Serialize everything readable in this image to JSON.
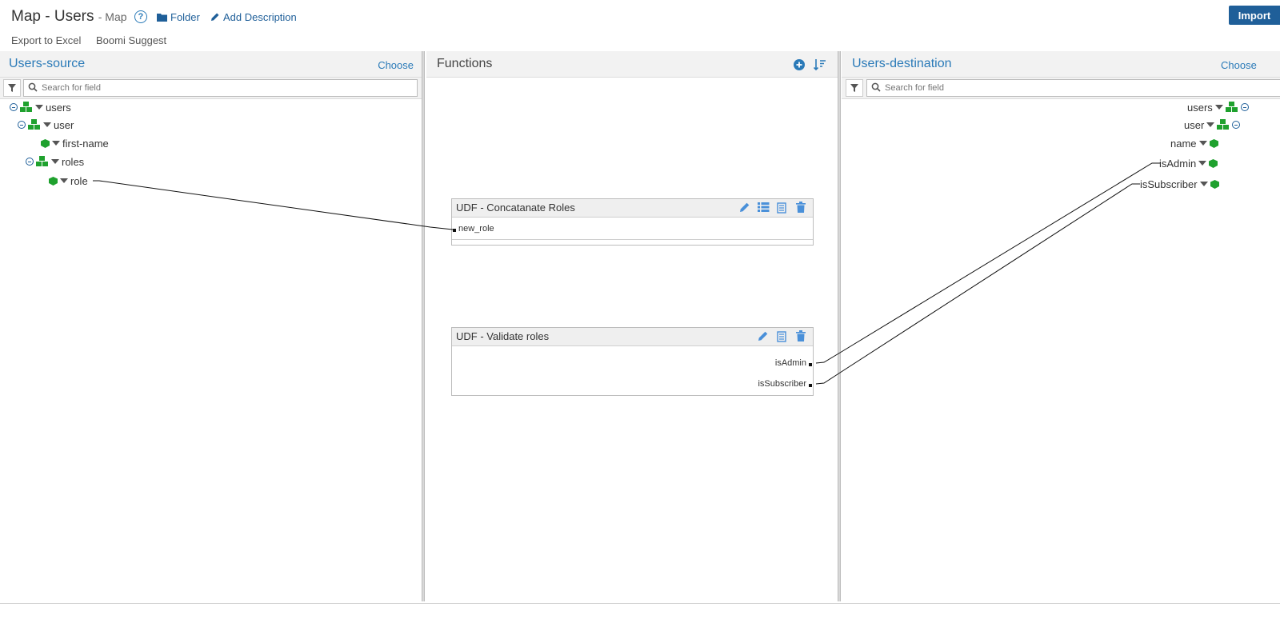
{
  "header": {
    "title": "Map - Users",
    "subtitle": "- Map",
    "folder_label": "Folder",
    "description_label": "Add Description",
    "import_label": "Import"
  },
  "submenu": {
    "export_label": "Export to Excel",
    "suggest_label": "Boomi Suggest"
  },
  "source": {
    "title": "Users-source",
    "choose_label": "Choose",
    "search_placeholder": "Search for field",
    "tree": [
      {
        "label": "users"
      },
      {
        "label": "user"
      },
      {
        "label": "first-name"
      },
      {
        "label": "roles"
      },
      {
        "label": "role"
      }
    ]
  },
  "functions": {
    "title": "Functions",
    "boxes": [
      {
        "title": "UDF - Concatanate Roles",
        "inputs": [
          "new_role"
        ]
      },
      {
        "title": "UDF - Validate roles",
        "outputs": [
          "isAdmin",
          "isSubscriber"
        ]
      }
    ]
  },
  "destination": {
    "title": "Users-destination",
    "choose_label": "Choose",
    "search_placeholder": "Search for field",
    "tree": [
      {
        "label": "users"
      },
      {
        "label": "user"
      },
      {
        "label": "name"
      },
      {
        "label": "isAdmin"
      },
      {
        "label": "isSubscriber"
      }
    ]
  },
  "colors": {
    "accent": "#2a7ab8",
    "import_button": "#1f5f99",
    "element_icon": "#1fa12e",
    "panel_header": "#f2f2f2"
  },
  "icons": {
    "help": "help-icon",
    "folder": "folder-icon",
    "pencil": "pencil-icon",
    "filter": "filter-icon",
    "search": "search-icon",
    "add": "plus-circle-icon",
    "sort": "sort-icon",
    "list": "list-icon",
    "copy": "copy-icon",
    "delete": "trash-icon",
    "element": "green-cube-icon",
    "group": "green-cubes-icon"
  }
}
